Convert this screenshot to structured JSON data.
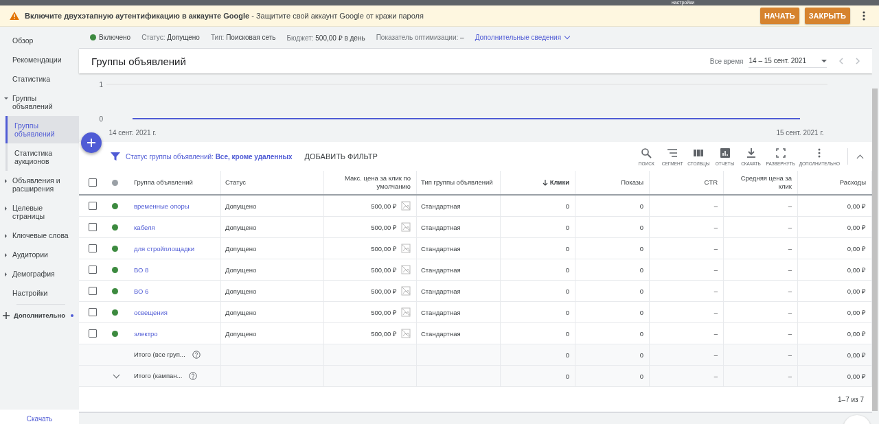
{
  "tooltip": "настройки",
  "banner": {
    "title": "Включите двухэтапную аутентификацию в аккаунте Google",
    "text": " - Защитите свой аккаунт Google от кражи пароля",
    "buttons": [
      "НАЧАТЬ",
      "ЗАКРЫТЬ"
    ]
  },
  "sidebar": {
    "items": [
      {
        "label": "Обзор",
        "selected": false
      },
      {
        "label": "Рекомендации",
        "selected": false
      },
      {
        "label": "Статистика",
        "selected": false
      },
      {
        "label": "Группы объявлений",
        "selected": false,
        "expanded": true,
        "children": [
          {
            "label": "Группы объявлений",
            "selected": true
          },
          {
            "label": "Статистика аукционов",
            "selected": false
          }
        ]
      },
      {
        "label": "Объявления и расширения",
        "selected": false,
        "expanded": false
      },
      {
        "label": "Целевые страницы",
        "selected": false,
        "expanded": false
      },
      {
        "label": "Ключевые слова",
        "selected": false,
        "expanded": false
      },
      {
        "label": "Аудитории",
        "selected": false,
        "expanded": false
      },
      {
        "label": "Демография",
        "selected": false,
        "expanded": false
      },
      {
        "label": "Настройки",
        "selected": false
      }
    ],
    "more": "Дополнительно",
    "download": "Скачать"
  },
  "campaign_status": {
    "state": "Включено",
    "color": "#3c8a3f",
    "items": [
      {
        "label": "Статус:",
        "value": "Допущено"
      },
      {
        "label": "Тип:",
        "value": "Поисковая сеть"
      },
      {
        "label": "Бюджет:",
        "value": "500,00 ₽ в день"
      },
      {
        "label": "Показатель оптимизации:",
        "value": "–"
      }
    ],
    "details_link": "Дополнительные сведения"
  },
  "page_title": "Группы объявлений",
  "date_range": {
    "label": "Все время",
    "value": "14 – 15 сент. 2021"
  },
  "chart": {
    "chart_data": {
      "type": "line",
      "categories": [
        "14 сент. 2021 г.",
        "15 сент. 2021 г."
      ],
      "series": [
        {
          "color": "#4f5bd5",
          "values": [
            0,
            0
          ]
        }
      ],
      "ylim": [
        0,
        1
      ],
      "yticks": [
        0,
        1
      ]
    }
  },
  "filter": {
    "label": "Статус группы объявлений:",
    "value": "Все, кроме удаленных",
    "add": "ДОБАВИТЬ ФИЛЬТР"
  },
  "tools": [
    "ПОИСК",
    "СЕГМЕНТ",
    "СТОЛБЦЫ",
    "ОТЧЕТЫ",
    "СКАЧАТЬ",
    "РАЗВЕРНУТЬ",
    "ДОПОЛНИТЕЛЬНО"
  ],
  "table": {
    "select_all_checked": false,
    "columns": [
      "Группа объявлений",
      "Статус",
      "Макс. цена за клик по умолчанию",
      "Тип группы объявлений",
      "Клики",
      "Показы",
      "CTR",
      "Средняя цена за клик",
      "Расходы"
    ],
    "rows": [
      {
        "checked": false,
        "color": "#3c8a3f",
        "cells": [
          "временные опоры",
          "Допущено",
          "500,00 ₽",
          "Стандартная",
          "0",
          "0",
          "–",
          "–",
          "0,00 ₽"
        ]
      },
      {
        "checked": false,
        "color": "#3c8a3f",
        "cells": [
          "кабеля",
          "Допущено",
          "500,00 ₽",
          "Стандартная",
          "0",
          "0",
          "–",
          "–",
          "0,00 ₽"
        ]
      },
      {
        "checked": false,
        "color": "#3c8a3f",
        "cells": [
          "для стройплощадки",
          "Допущено",
          "500,00 ₽",
          "Стандартная",
          "0",
          "0",
          "–",
          "–",
          "0,00 ₽"
        ]
      },
      {
        "checked": false,
        "color": "#3c8a3f",
        "cells": [
          "ВО 8",
          "Допущено",
          "500,00 ₽",
          "Стандартная",
          "0",
          "0",
          "–",
          "–",
          "0,00 ₽"
        ]
      },
      {
        "checked": false,
        "color": "#3c8a3f",
        "cells": [
          "ВО 6",
          "Допущено",
          "500,00 ₽",
          "Стандартная",
          "0",
          "0",
          "–",
          "–",
          "0,00 ₽"
        ]
      },
      {
        "checked": false,
        "color": "#3c8a3f",
        "cells": [
          "освещения",
          "Допущено",
          "500,00 ₽",
          "Стандартная",
          "0",
          "0",
          "–",
          "–",
          "0,00 ₽"
        ]
      },
      {
        "checked": false,
        "color": "#3c8a3f",
        "cells": [
          "электро",
          "Допущено",
          "500,00 ₽",
          "Стандартная",
          "0",
          "0",
          "–",
          "–",
          "0,00 ₽"
        ]
      }
    ],
    "totals": [
      {
        "cells": [
          "Итого (все груп...",
          "0",
          "0",
          "–",
          "–",
          "0,00 ₽"
        ]
      },
      {
        "expanded": false,
        "cells": [
          "Итого (кампан...",
          "0",
          "0",
          "–",
          "–",
          "0,00 ₽"
        ]
      }
    ],
    "pagination": "1–7 из 7"
  }
}
